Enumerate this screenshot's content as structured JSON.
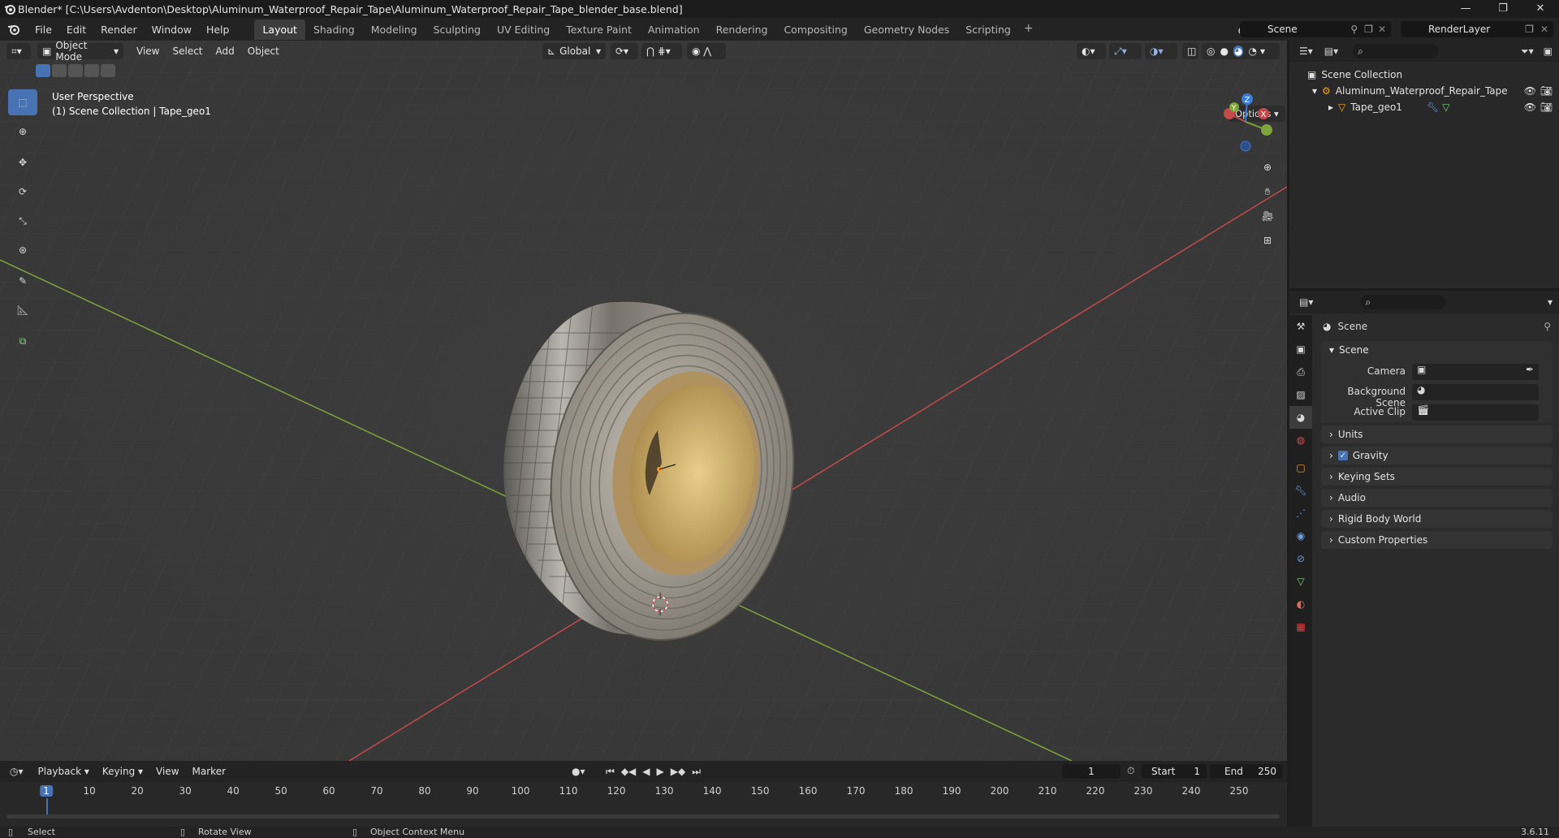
{
  "window": {
    "title": "Blender* [C:\\Users\\Avdenton\\Desktop\\Aluminum_Waterproof_Repair_Tape\\Aluminum_Waterproof_Repair_Tape_blender_base.blend]"
  },
  "menu": [
    "File",
    "Edit",
    "Render",
    "Window",
    "Help"
  ],
  "workspaces": [
    "Layout",
    "Shading",
    "Modeling",
    "Sculpting",
    "UV Editing",
    "Texture Paint",
    "Animation",
    "Rendering",
    "Compositing",
    "Geometry Nodes",
    "Scripting"
  ],
  "active_workspace": "Layout",
  "scene_name": "Scene",
  "view_layer": "RenderLayer",
  "viewport": {
    "mode": "Object Mode",
    "menus": [
      "View",
      "Select",
      "Add",
      "Object"
    ],
    "orientation": "Global",
    "options": "Options",
    "overlay_line1": "User Perspective",
    "overlay_line2": "(1) Scene Collection | Tape_geo1",
    "gizmo": {
      "x": "X",
      "y": "Y",
      "z": "Z"
    }
  },
  "outliner": {
    "root": "Scene Collection",
    "collection": "Aluminum_Waterproof_Repair_Tape",
    "object": "Tape_geo1"
  },
  "properties": {
    "context": "Scene",
    "panel_scene": "Scene",
    "camera_label": "Camera",
    "bg_scene_label": "Background Scene",
    "active_clip_label": "Active Clip",
    "panels": [
      "Units",
      "Gravity",
      "Keying Sets",
      "Audio",
      "Rigid Body World",
      "Custom Properties"
    ],
    "gravity_checked": true
  },
  "timeline": {
    "menus": [
      "Playback",
      "Keying",
      "View",
      "Marker"
    ],
    "current_frame": "1",
    "start_label": "Start",
    "start": "1",
    "end_label": "End",
    "end": "250",
    "ticks": [
      "1",
      "10",
      "20",
      "30",
      "40",
      "50",
      "60",
      "70",
      "80",
      "90",
      "100",
      "110",
      "120",
      "130",
      "140",
      "150",
      "160",
      "170",
      "180",
      "190",
      "200",
      "210",
      "220",
      "230",
      "240",
      "250"
    ]
  },
  "statusbar": {
    "select": "Select",
    "rotate": "Rotate View",
    "context_menu": "Object Context Menu",
    "version": "3.6.11"
  },
  "colors": {
    "accent": "#4772b3",
    "x_axis": "#c44a4a",
    "y_axis": "#7fa43b",
    "z_axis": "#3d7ad6"
  }
}
